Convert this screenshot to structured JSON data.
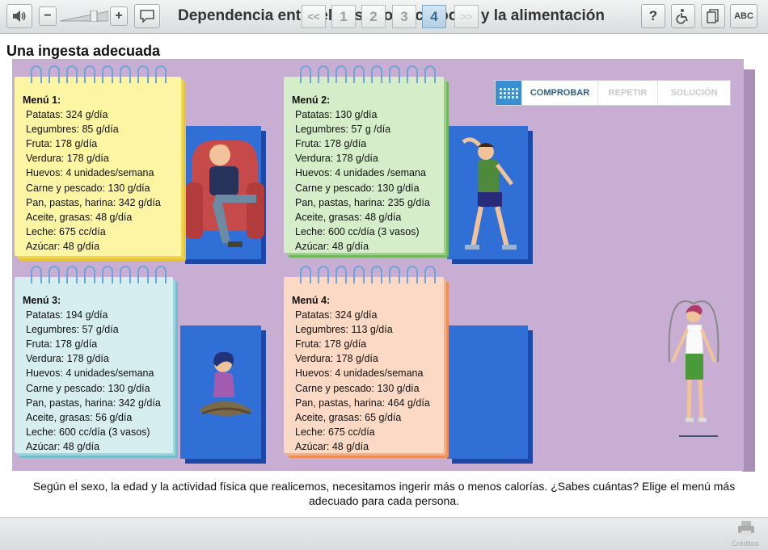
{
  "header": {
    "title": "Dependencia entre el desarrollo corporal y la alimentación",
    "volume_level": 0.7,
    "minus_label": "−",
    "plus_label": "+",
    "help_label": "?",
    "abc_label": "ABC"
  },
  "section_title": "Una ingesta adecuada",
  "check_bar": {
    "check_label": "COMPROBAR",
    "repeat_label": "REPETIR",
    "solution_label": "SOLUCIÓN"
  },
  "menus": [
    {
      "title": "Menú 1:",
      "items": [
        "Patatas: 324 g/día",
        "Legumbres: 85 g/día",
        "Fruta: 178 g/día",
        "Verdura: 178 g/día",
        "Huevos: 4 unidades/semana",
        "Carne y pescado: 130 g/día",
        "Pan, pastas, harina: 342 g/día",
        "Aceite, grasas: 48 g/día",
        "Leche: 675 cc/día",
        "Azúcar: 48 g/día"
      ],
      "color": "#fbf5a4"
    },
    {
      "title": "Menú 2:",
      "items": [
        "Patatas: 130 g/día",
        "Legumbres: 57 g /día",
        "Fruta: 178 g/día",
        "Verdura: 178 g/día",
        "Huevos: 4 unidades /semana",
        "Carne y pescado: 130 g/día",
        "Pan, pastas, harina: 235 g/día",
        "Aceite, grasas: 48 g/día",
        "Leche: 600 cc/día (3 vasos)",
        "Azúcar: 48 g/día"
      ],
      "color": "#d6edc9"
    },
    {
      "title": "Menú 3:",
      "items": [
        "Patatas: 194 g/día",
        "Legumbres: 57 g/día",
        "Fruta: 178 g/día",
        "Verdura: 178 g/día",
        "Huevos: 4 unidades/semana",
        "Carne y pescado: 130 g/día",
        "Pan, pastas, harina: 342 g/día",
        "Aceite, grasas: 56 g/día",
        "Leche: 600 cc/día (3 vasos)",
        "Azúcar: 48 g/día"
      ],
      "color": "#d6eef0"
    },
    {
      "title": "Menú 4:",
      "items": [
        "Patatas: 324 g/día",
        "Legumbres: 113 g/día",
        "Fruta: 178 g/día",
        "Verdura: 178 g/día",
        "Huevos: 4 unidades/semana",
        "Carne y pescado: 130 g/día",
        "Pan, pastas, harina: 464 g/día",
        "Aceite, grasas: 65 g/día",
        "Leche: 675 cc/día",
        "Azúcar: 48 g/día"
      ],
      "color": "#fbd9c4"
    }
  ],
  "instructions": "Según el sexo, la edad y la actividad física que realicemos, necesitamos ingerir más o menos calorías. ¿Sabes cuántas? Elige el menú más adecuado para cada persona.",
  "pagination": {
    "prev_label": "<<",
    "pages": [
      "1",
      "2",
      "3",
      "4"
    ],
    "current_page": "4",
    "next_label": ">>"
  },
  "credits_label": "Créditos"
}
